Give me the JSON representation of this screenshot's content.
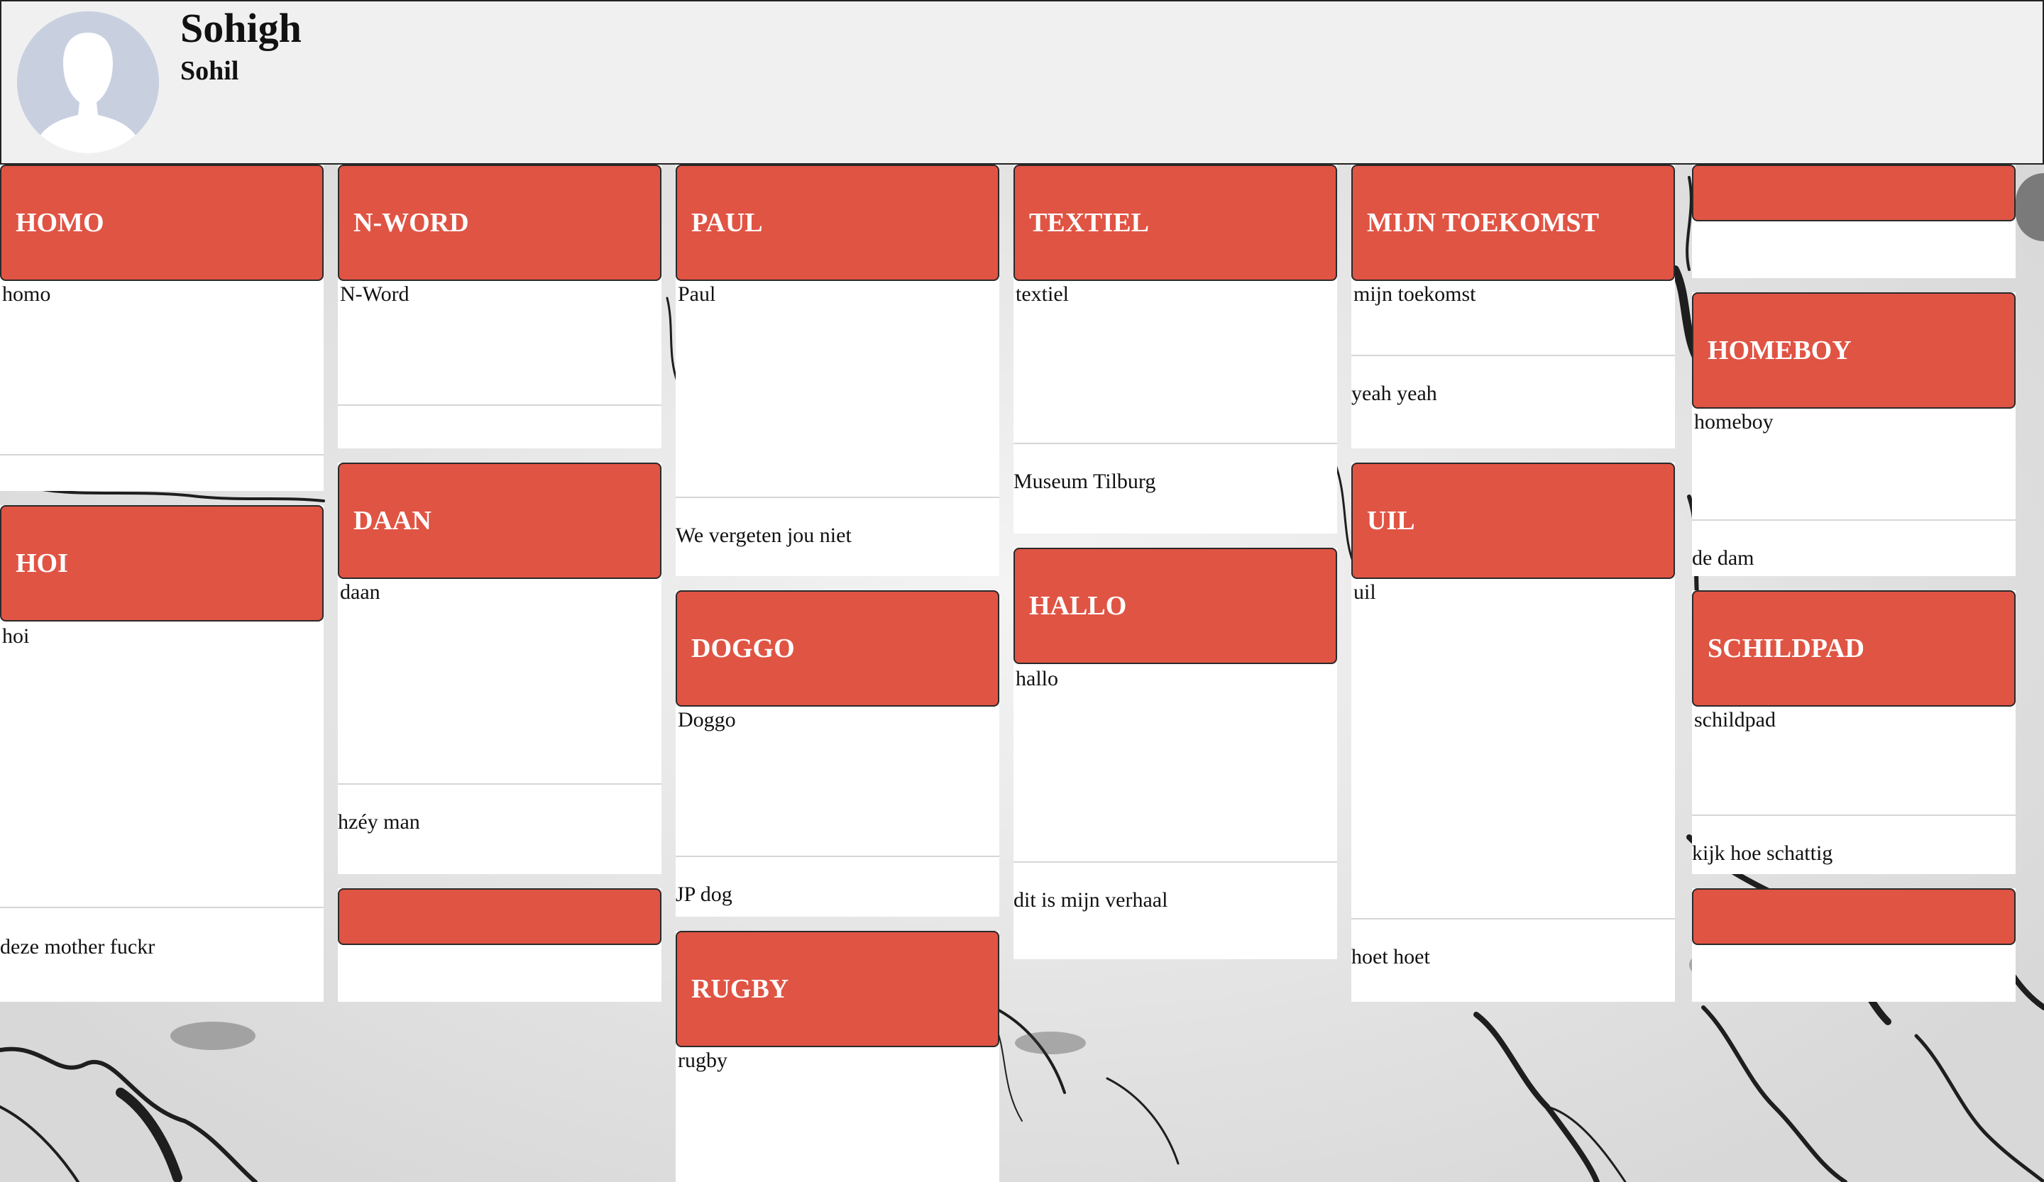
{
  "profile": {
    "name": "Sohigh",
    "username": "Sohil"
  },
  "columns": [
    {
      "cards": [
        {
          "title": "HOMO",
          "description": "homo",
          "footer": ""
        },
        {
          "title": "HOI",
          "description": "hoi",
          "footer": "deze mother fuckr"
        }
      ]
    },
    {
      "cards": [
        {
          "title": "N-WORD",
          "description": "N-Word",
          "footer": ""
        },
        {
          "title": "DAAN",
          "description": "daan",
          "footer": "hzéy man"
        },
        {
          "title": "",
          "description": "",
          "footer": ""
        }
      ]
    },
    {
      "cards": [
        {
          "title": "PAUL",
          "description": "Paul",
          "footer": "We vergeten jou niet"
        },
        {
          "title": "DOGGO",
          "description": "Doggo",
          "footer": "JP dog"
        },
        {
          "title": "RUGBY",
          "description": "rugby",
          "footer": ""
        }
      ]
    },
    {
      "cards": [
        {
          "title": "TEXTIEL",
          "description": "textiel",
          "footer": "Museum Tilburg"
        },
        {
          "title": "HALLO",
          "description": "hallo",
          "footer": "dit is mijn verhaal"
        }
      ]
    },
    {
      "cards": [
        {
          "title": "MIJN TOEKOMST",
          "description": "mijn toekomst",
          "footer": "yeah yeah"
        },
        {
          "title": "UIL",
          "description": "uil",
          "footer": "hoet hoet"
        }
      ]
    },
    {
      "cards": [
        {
          "title": "",
          "description": "",
          "footer": ""
        },
        {
          "title": "HOMEBOY",
          "description": "homeboy",
          "footer": "de dam"
        },
        {
          "title": "SCHILDPAD",
          "description": "schildpad",
          "footer": "kijk hoe schattig"
        },
        {
          "title": "",
          "description": "",
          "footer": ""
        }
      ]
    }
  ],
  "colors": {
    "card_header": "#e05444",
    "header_bg": "#f0f0f0"
  }
}
